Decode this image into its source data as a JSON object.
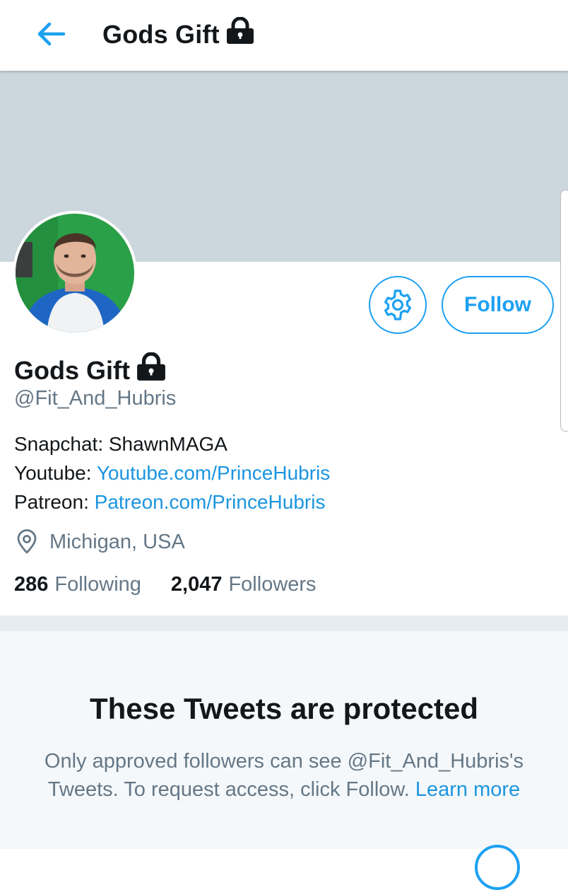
{
  "header": {
    "title": "Gods Gift",
    "back_icon": "arrow-left-icon",
    "lock_icon": "lock-icon"
  },
  "profile": {
    "display_name": "Gods Gift",
    "handle": "@Fit_And_Hubris",
    "follow_label": "Follow",
    "settings_icon": "gear-icon",
    "bio": {
      "snapchat_label": "Snapchat: ShawnMAGA",
      "youtube_prefix": "Youtube: ",
      "youtube_link": "Youtube.com/PrinceHubris",
      "patreon_prefix": "Patreon: ",
      "patreon_link": "Patreon.com/PrinceHubris"
    },
    "location": "Michigan, USA",
    "following_count": "286",
    "following_label": "Following",
    "followers_count": "2,047",
    "followers_label": "Followers"
  },
  "protected": {
    "title": "These Tweets are protected",
    "line1": "Only approved followers can see @Fit_And_Hubris's",
    "line2": "Tweets. To request access, click Follow.",
    "learn_more": "Learn more"
  },
  "colors": {
    "accent": "#1da1f2",
    "banner": "#ccd6dd",
    "secondary_text": "#657786"
  }
}
